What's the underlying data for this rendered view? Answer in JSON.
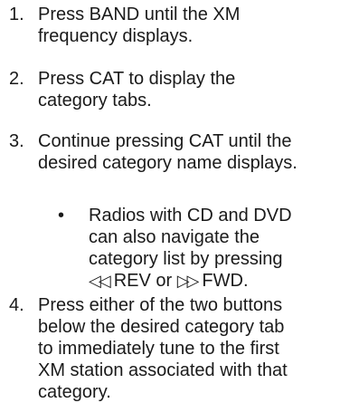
{
  "steps": [
    {
      "number": "1.",
      "lines": [
        "Press BAND until the XM",
        "frequency displays."
      ]
    },
    {
      "number": "2.",
      "lines": [
        "Press CAT to display the",
        "category tabs."
      ]
    },
    {
      "number": "3.",
      "lines": [
        "Continue pressing CAT until the",
        "desired category name displays."
      ]
    },
    {
      "number": "4.",
      "lines": [
        "Press either of the two buttons",
        "below the desired category tab",
        "to immediately tune to the first",
        "XM station associated with that",
        "category."
      ]
    }
  ],
  "note": {
    "bullet": "•",
    "lines": [
      "Radios with CD and DVD",
      "can also navigate the",
      "category list by pressing"
    ],
    "rev_icon": "◁◁",
    "rev_label": "REV or",
    "fwd_icon": "▷▷",
    "fwd_label": "FWD."
  }
}
